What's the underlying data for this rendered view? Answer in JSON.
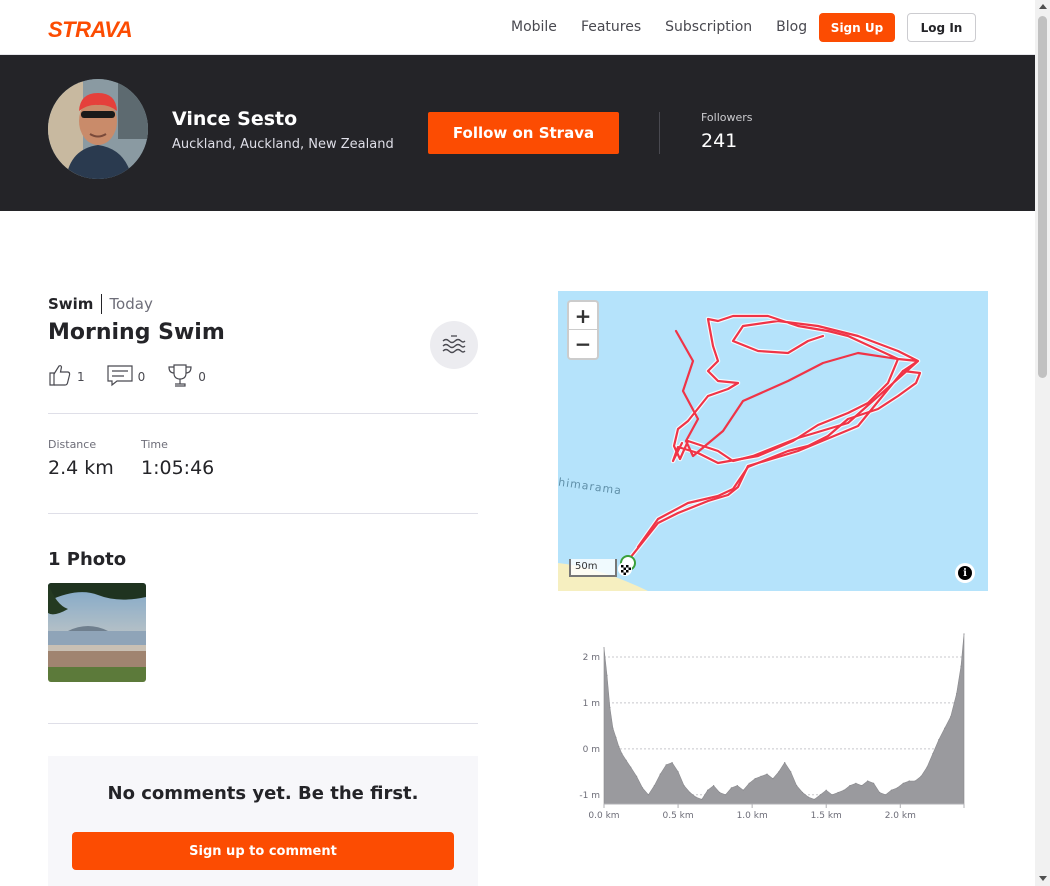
{
  "nav": {
    "logo": "STRAVA",
    "links": [
      "Mobile",
      "Features",
      "Subscription",
      "Blog"
    ],
    "signup_label": "Sign Up",
    "login_label": "Log In"
  },
  "athlete": {
    "name": "Vince Sesto",
    "location": "Auckland, Auckland, New Zealand",
    "follow_label": "Follow on Strava",
    "followers_label": "Followers",
    "followers_count": "241"
  },
  "activity": {
    "type": "Swim",
    "date": "Today",
    "title": "Morning Swim",
    "sport_icon": "swim-icon",
    "kudos": "1",
    "comments": "0",
    "achievements": "0",
    "stats": [
      {
        "label": "Distance",
        "value": "2.4 km"
      },
      {
        "label": "Time",
        "value": "1:05:46"
      }
    ],
    "photos_title": "1 Photo"
  },
  "comments": {
    "empty_text": "No comments yet. Be the first.",
    "signup_label": "Sign up to comment"
  },
  "map": {
    "zoom_in": "+",
    "zoom_out": "−",
    "scale_label": "50m",
    "place_label": "himarama",
    "info": "i",
    "route_color": "#f03447"
  },
  "chart_data": {
    "type": "area",
    "title": "",
    "xlabel": "",
    "ylabel": "",
    "x_ticks": [
      "0.0 km",
      "0.5 km",
      "1.0 km",
      "1.5 km",
      "2.0 km"
    ],
    "y_ticks": [
      "2 m",
      "1 m",
      "0 m",
      "-1 m"
    ],
    "xlim": [
      0,
      2.43
    ],
    "ylim": [
      -1.2,
      2.5
    ],
    "series": [
      {
        "x": [
          0.0,
          0.02,
          0.04,
          0.06,
          0.08,
          0.1,
          0.12,
          0.15,
          0.18,
          0.22,
          0.26,
          0.3,
          0.34,
          0.38,
          0.42,
          0.46,
          0.5,
          0.54,
          0.58,
          0.62,
          0.66,
          0.7,
          0.74,
          0.78,
          0.82,
          0.86,
          0.9,
          0.94,
          0.98,
          1.02,
          1.06,
          1.1,
          1.14,
          1.18,
          1.22,
          1.26,
          1.3,
          1.34,
          1.38,
          1.42,
          1.46,
          1.5,
          1.54,
          1.58,
          1.62,
          1.66,
          1.7,
          1.74,
          1.78,
          1.82,
          1.86,
          1.9,
          1.94,
          1.98,
          2.02,
          2.06,
          2.1,
          2.14,
          2.18,
          2.22,
          2.26,
          2.3,
          2.34,
          2.38,
          2.41,
          2.43
        ],
        "values": [
          2.2,
          1.6,
          0.9,
          0.45,
          0.25,
          0.05,
          -0.1,
          -0.25,
          -0.4,
          -0.6,
          -0.85,
          -1.0,
          -0.8,
          -0.55,
          -0.35,
          -0.3,
          -0.5,
          -0.8,
          -0.95,
          -1.05,
          -1.1,
          -0.9,
          -0.8,
          -0.95,
          -1.0,
          -0.85,
          -0.8,
          -0.9,
          -0.75,
          -0.65,
          -0.6,
          -0.55,
          -0.65,
          -0.5,
          -0.3,
          -0.5,
          -0.8,
          -0.95,
          -1.05,
          -1.1,
          -1.0,
          -0.9,
          -1.0,
          -0.95,
          -0.9,
          -0.8,
          -0.75,
          -0.8,
          -0.7,
          -0.75,
          -0.95,
          -1.0,
          -0.9,
          -0.85,
          -0.75,
          -0.7,
          -0.7,
          -0.6,
          -0.4,
          -0.1,
          0.2,
          0.45,
          0.7,
          1.2,
          1.8,
          2.5
        ]
      }
    ]
  }
}
